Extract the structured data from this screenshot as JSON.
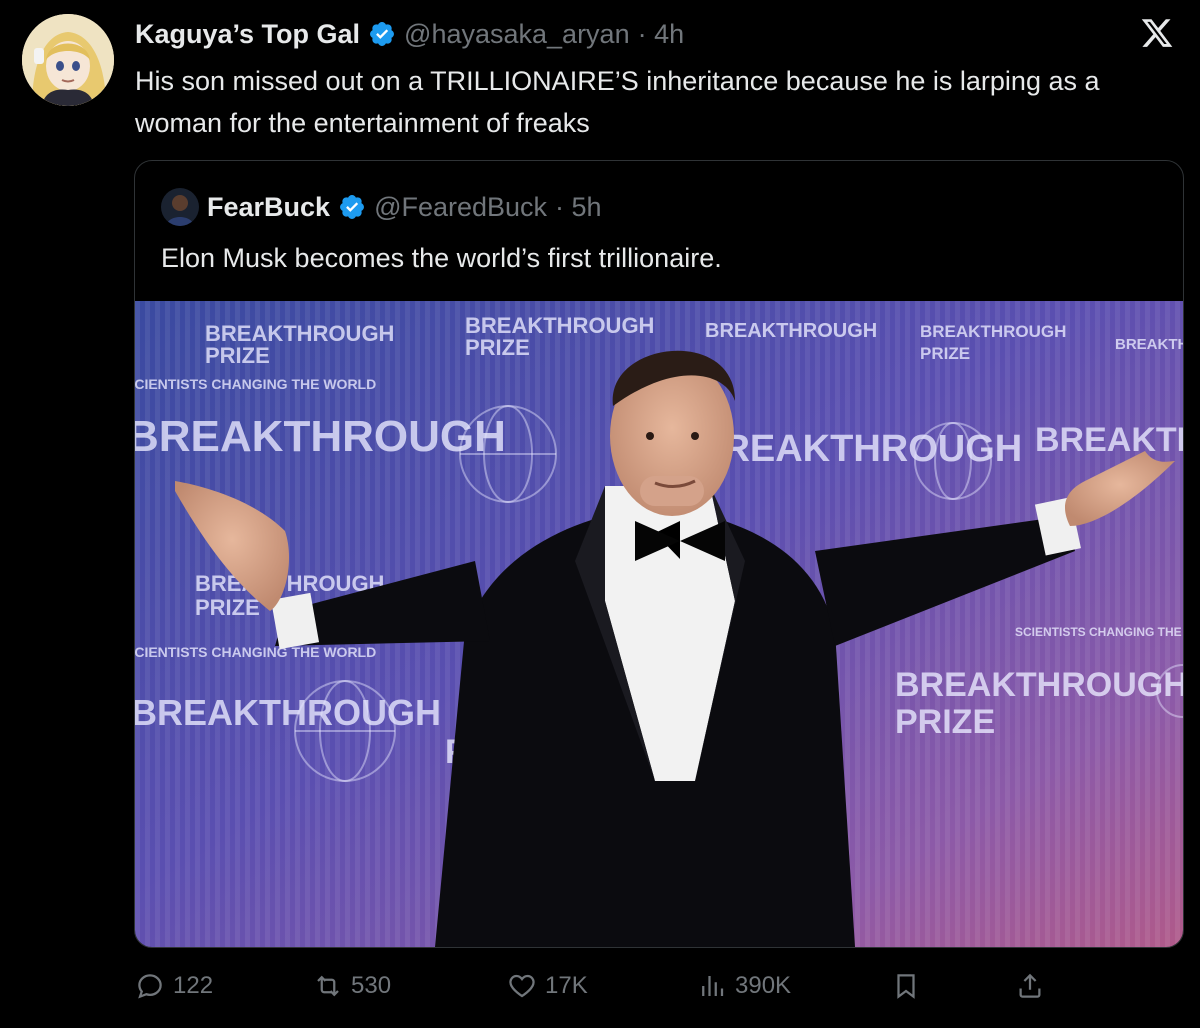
{
  "tweet": {
    "display_name": "Kaguya’s Top Gal",
    "handle": "@hayasaka_aryan",
    "time": "· 4h",
    "text": "His son missed out on a TRILLIONAIRE’S inheritance because he is larping as a woman for the entertainment of freaks"
  },
  "quote": {
    "display_name": "FearBuck",
    "handle": "@FearedBuck",
    "time": "· 5h",
    "text": "Elon Musk becomes the world’s first trillionaire.",
    "image_text": {
      "backdrop_words": [
        "BREAKTHROUGH",
        "PRIZE",
        "SCIENTISTS CHANGING THE WORLD"
      ]
    }
  },
  "actions": {
    "replies": "122",
    "reposts": "530",
    "likes": "17K",
    "views": "390K"
  },
  "colors": {
    "background": "#000000",
    "text_primary": "#e7e9ea",
    "text_secondary": "#71767b",
    "verified_blue": "#1d9bf0",
    "border": "#2f3336"
  },
  "icons": [
    "verified-badge-icon",
    "x-logo-icon",
    "reply-icon",
    "repost-icon",
    "like-icon",
    "views-icon",
    "bookmark-icon",
    "share-icon"
  ]
}
